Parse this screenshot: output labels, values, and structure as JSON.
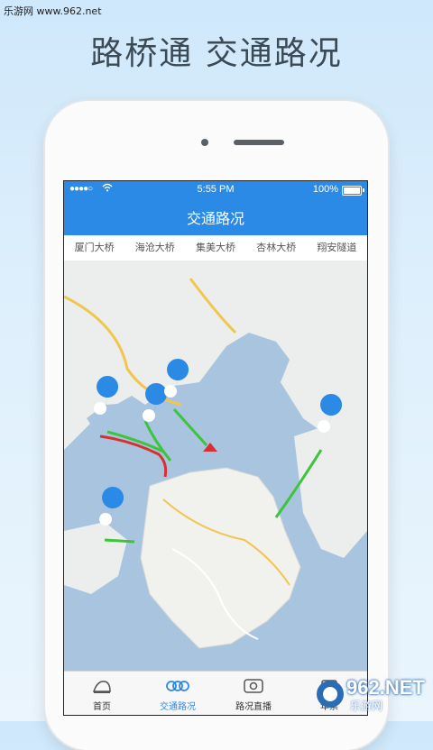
{
  "watermark": "乐游网 www.962.net",
  "promo": {
    "title": "路桥通 交通路况"
  },
  "status": {
    "signal": "●●●●○",
    "time": "5:55 PM",
    "battery": "100%"
  },
  "nav": {
    "title": "交通路况"
  },
  "bridges": [
    "厦门大桥",
    "海沧大桥",
    "集美大桥",
    "杏林大桥",
    "翔安隧道"
  ],
  "tabs": [
    {
      "label": "首页",
      "icon": "home-icon"
    },
    {
      "label": "交通路况",
      "icon": "traffic-icon",
      "active": true
    },
    {
      "label": "路况直播",
      "icon": "live-camera-icon"
    },
    {
      "label": "年票",
      "icon": "ticket-icon"
    }
  ],
  "brand": {
    "name": "962.NET",
    "sub": "乐游网"
  },
  "colors": {
    "accent": "#2b8ae6",
    "water": "#a9c4de",
    "land": "#eef0ee",
    "traffic_green": "#3cc43c",
    "traffic_red": "#d83030"
  }
}
